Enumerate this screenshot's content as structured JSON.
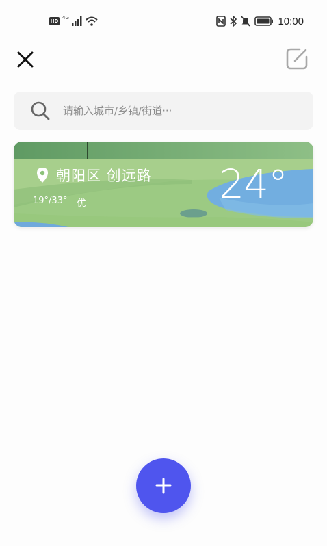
{
  "status_bar": {
    "hd_badge": "HD",
    "network_gen": "4G",
    "time": "10:00",
    "icons": [
      "hd-icon",
      "signal-icon",
      "wifi-icon",
      "nfc-icon",
      "bluetooth-icon",
      "mute-icon",
      "battery-icon"
    ]
  },
  "topbar": {
    "icons": [
      "close-icon",
      "edit-icon"
    ]
  },
  "search": {
    "placeholder": "请输入城市/乡镇/街道···",
    "value": "",
    "icon": "search-icon"
  },
  "weather_card": {
    "location": "朝阳区 创远路",
    "temp_range": "19°/33°",
    "air_quality": "优",
    "temperature": "24°",
    "icon": "location-pin-icon"
  },
  "fab": {
    "icon": "plus-icon",
    "color": "#4f55ee"
  },
  "colors": {
    "accent": "#4f55ee",
    "card_green": "#8cc27a",
    "card_water": "#6fa9dc"
  }
}
